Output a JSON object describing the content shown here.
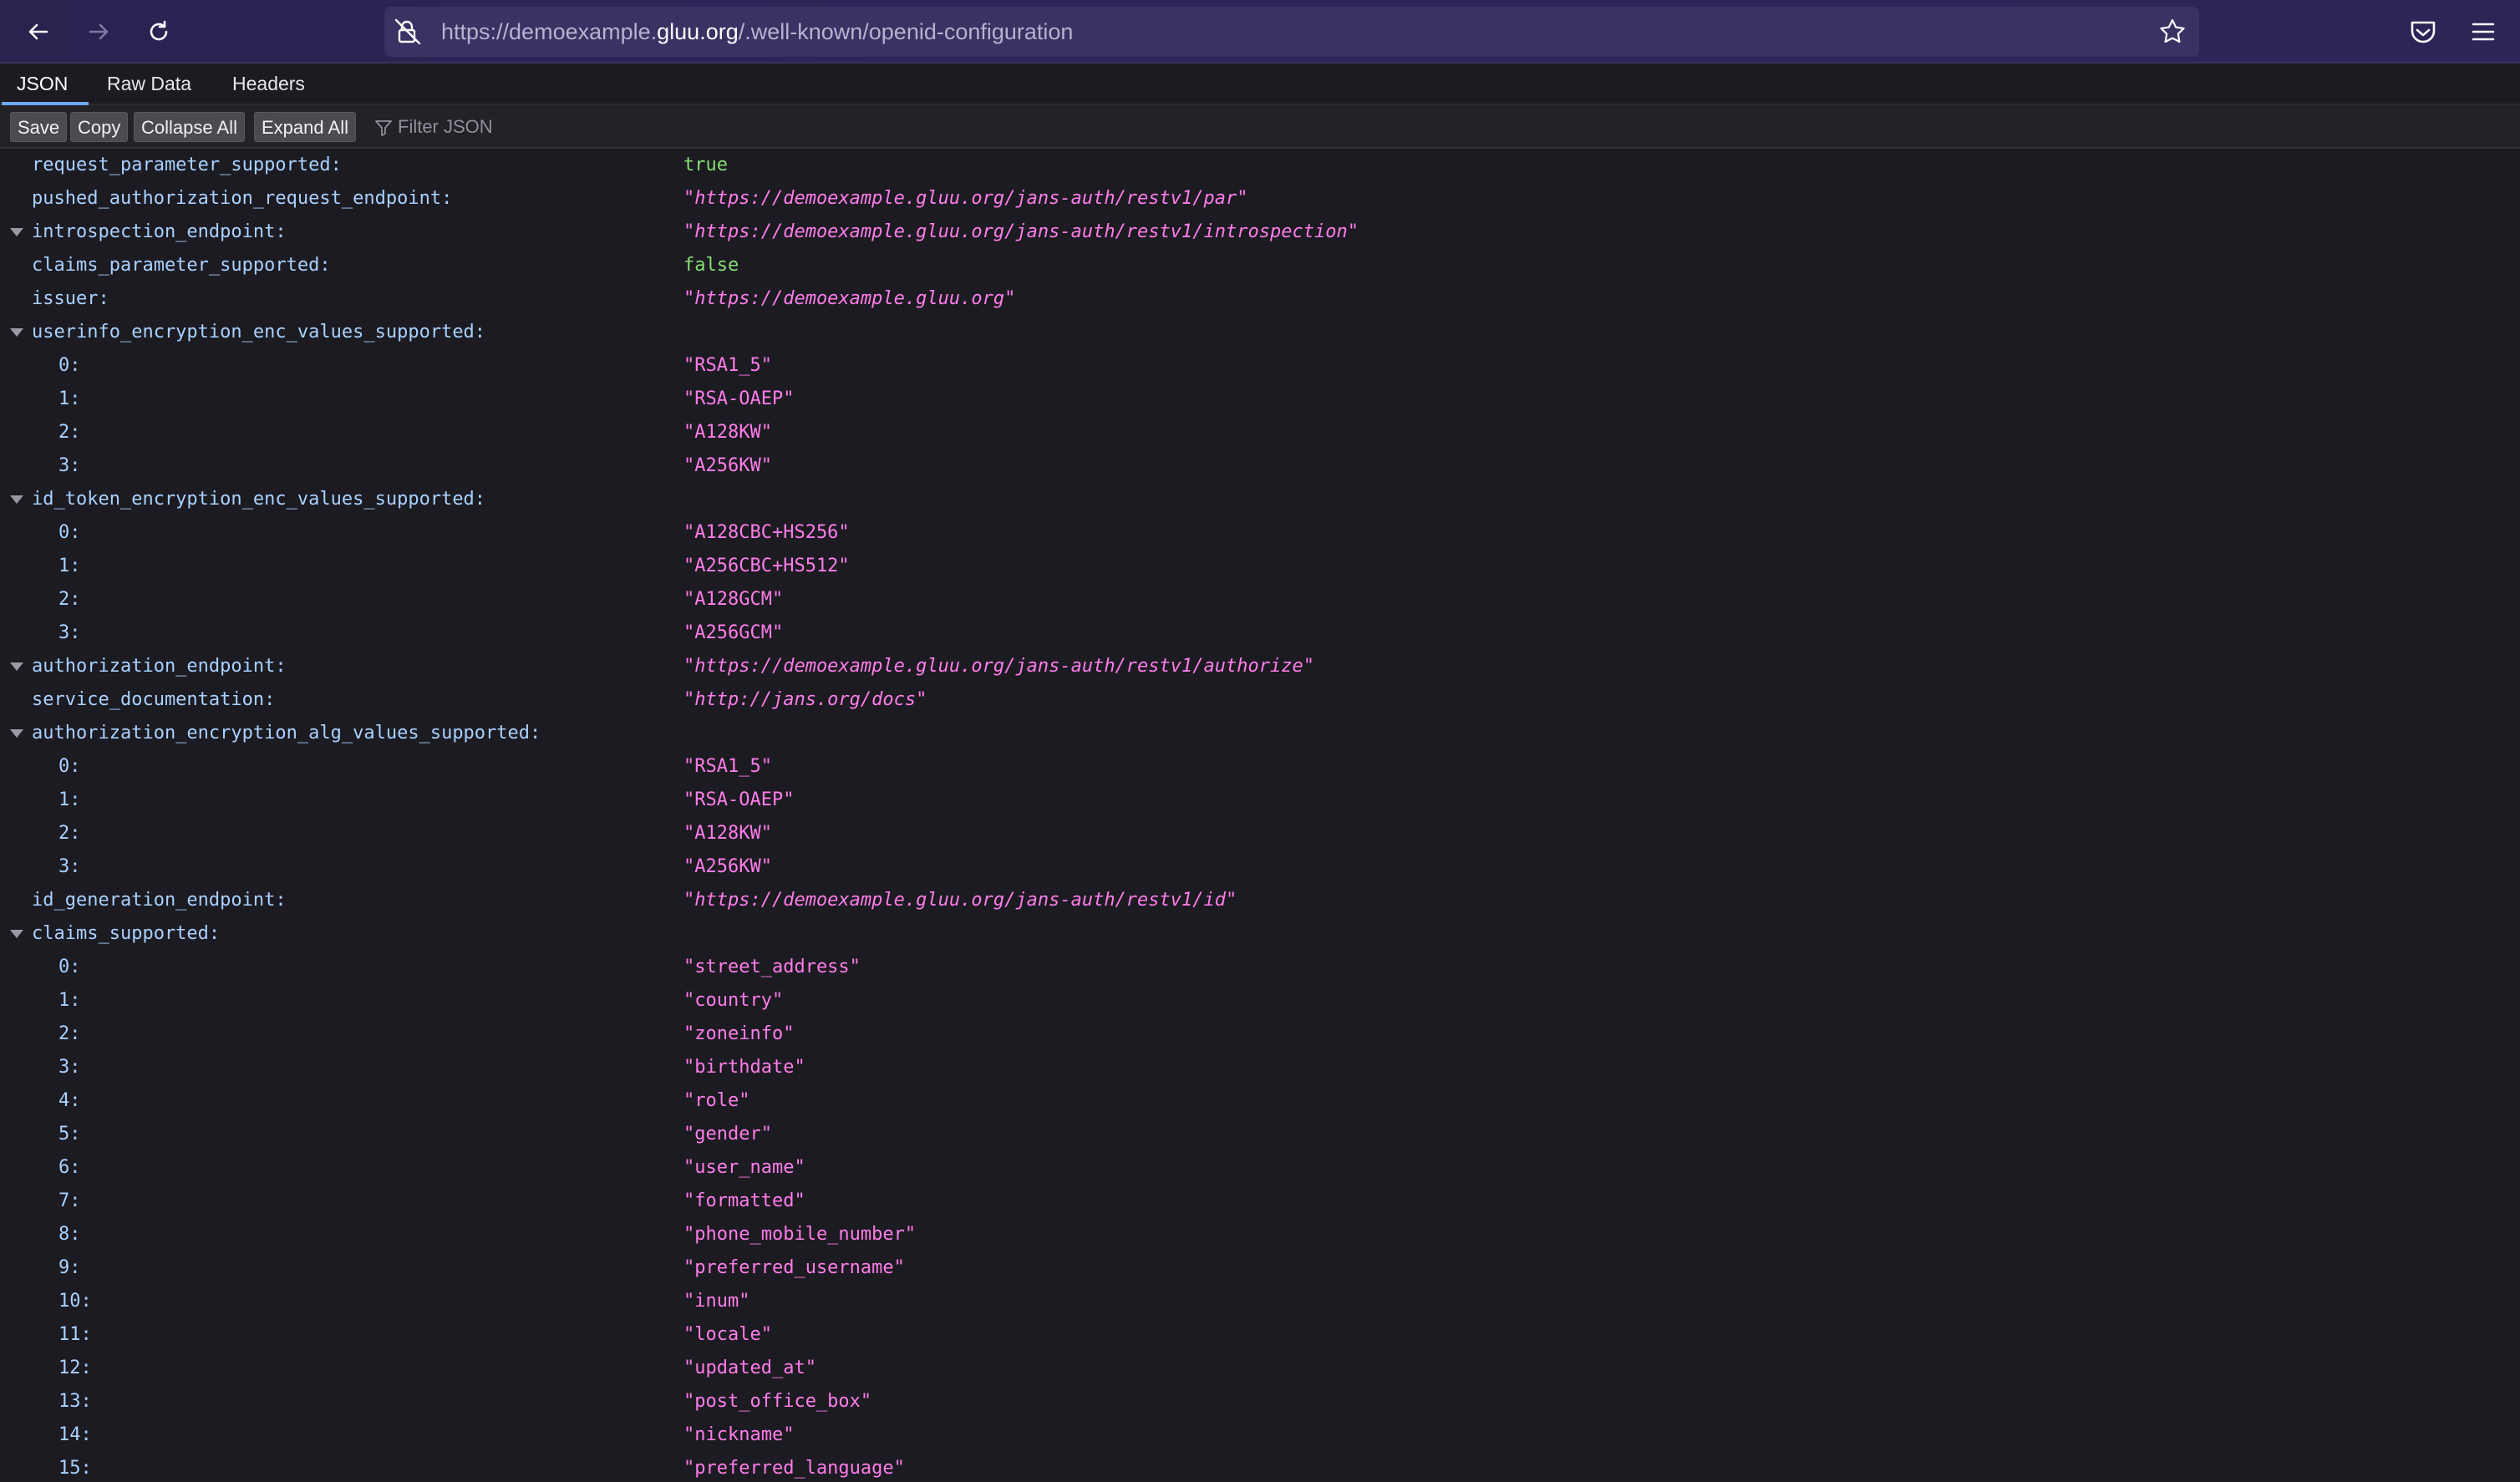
{
  "browser": {
    "url_prefix": "https://demoexample.",
    "url_host": "gluu.org",
    "url_path": "/.well-known/openid-configuration"
  },
  "tabs": [
    {
      "label": "JSON",
      "active": true
    },
    {
      "label": "Raw Data",
      "active": false
    },
    {
      "label": "Headers",
      "active": false
    }
  ],
  "actions": {
    "save": "Save",
    "copy": "Copy",
    "collapse_all": "Collapse All",
    "expand_all": "Expand All",
    "filter_placeholder": "Filter JSON"
  },
  "rows": [
    {
      "key": "request_parameter_supported:",
      "value": "true",
      "type": "bool",
      "level": 0,
      "expandable": false
    },
    {
      "key": "pushed_authorization_request_endpoint:",
      "value": "\"https://demoexample.gluu.org/jans-auth/restv1/par\"",
      "type": "url",
      "level": 0,
      "expandable": false
    },
    {
      "key": "introspection_endpoint:",
      "value": "\"https://demoexample.gluu.org/jans-auth/restv1/introspection\"",
      "type": "url",
      "level": 0,
      "expandable": true
    },
    {
      "key": "claims_parameter_supported:",
      "value": "false",
      "type": "bool",
      "level": 0,
      "expandable": false
    },
    {
      "key": "issuer:",
      "value": "\"https://demoexample.gluu.org\"",
      "type": "url",
      "level": 0,
      "expandable": false
    },
    {
      "key": "userinfo_encryption_enc_values_supported:",
      "value": "",
      "type": "obj",
      "level": 0,
      "expandable": true
    },
    {
      "key": "0:",
      "value": "\"RSA1_5\"",
      "type": "str",
      "level": 1,
      "expandable": false
    },
    {
      "key": "1:",
      "value": "\"RSA-OAEP\"",
      "type": "str",
      "level": 1,
      "expandable": false
    },
    {
      "key": "2:",
      "value": "\"A128KW\"",
      "type": "str",
      "level": 1,
      "expandable": false
    },
    {
      "key": "3:",
      "value": "\"A256KW\"",
      "type": "str",
      "level": 1,
      "expandable": false
    },
    {
      "key": "id_token_encryption_enc_values_supported:",
      "value": "",
      "type": "obj",
      "level": 0,
      "expandable": true
    },
    {
      "key": "0:",
      "value": "\"A128CBC+HS256\"",
      "type": "str",
      "level": 1,
      "expandable": false
    },
    {
      "key": "1:",
      "value": "\"A256CBC+HS512\"",
      "type": "str",
      "level": 1,
      "expandable": false
    },
    {
      "key": "2:",
      "value": "\"A128GCM\"",
      "type": "str",
      "level": 1,
      "expandable": false
    },
    {
      "key": "3:",
      "value": "\"A256GCM\"",
      "type": "str",
      "level": 1,
      "expandable": false
    },
    {
      "key": "authorization_endpoint:",
      "value": "\"https://demoexample.gluu.org/jans-auth/restv1/authorize\"",
      "type": "url",
      "level": 0,
      "expandable": true
    },
    {
      "key": "service_documentation:",
      "value": "\"http://jans.org/docs\"",
      "type": "url",
      "level": 0,
      "expandable": false
    },
    {
      "key": "authorization_encryption_alg_values_supported:",
      "value": "",
      "type": "obj",
      "level": 0,
      "expandable": true
    },
    {
      "key": "0:",
      "value": "\"RSA1_5\"",
      "type": "str",
      "level": 1,
      "expandable": false
    },
    {
      "key": "1:",
      "value": "\"RSA-OAEP\"",
      "type": "str",
      "level": 1,
      "expandable": false
    },
    {
      "key": "2:",
      "value": "\"A128KW\"",
      "type": "str",
      "level": 1,
      "expandable": false
    },
    {
      "key": "3:",
      "value": "\"A256KW\"",
      "type": "str",
      "level": 1,
      "expandable": false
    },
    {
      "key": "id_generation_endpoint:",
      "value": "\"https://demoexample.gluu.org/jans-auth/restv1/id\"",
      "type": "url",
      "level": 0,
      "expandable": false
    },
    {
      "key": "claims_supported:",
      "value": "",
      "type": "obj",
      "level": 0,
      "expandable": true
    },
    {
      "key": "0:",
      "value": "\"street_address\"",
      "type": "str",
      "level": 1,
      "expandable": false
    },
    {
      "key": "1:",
      "value": "\"country\"",
      "type": "str",
      "level": 1,
      "expandable": false
    },
    {
      "key": "2:",
      "value": "\"zoneinfo\"",
      "type": "str",
      "level": 1,
      "expandable": false
    },
    {
      "key": "3:",
      "value": "\"birthdate\"",
      "type": "str",
      "level": 1,
      "expandable": false
    },
    {
      "key": "4:",
      "value": "\"role\"",
      "type": "str",
      "level": 1,
      "expandable": false
    },
    {
      "key": "5:",
      "value": "\"gender\"",
      "type": "str",
      "level": 1,
      "expandable": false
    },
    {
      "key": "6:",
      "value": "\"user_name\"",
      "type": "str",
      "level": 1,
      "expandable": false
    },
    {
      "key": "7:",
      "value": "\"formatted\"",
      "type": "str",
      "level": 1,
      "expandable": false
    },
    {
      "key": "8:",
      "value": "\"phone_mobile_number\"",
      "type": "str",
      "level": 1,
      "expandable": false
    },
    {
      "key": "9:",
      "value": "\"preferred_username\"",
      "type": "str",
      "level": 1,
      "expandable": false
    },
    {
      "key": "10:",
      "value": "\"inum\"",
      "type": "str",
      "level": 1,
      "expandable": false
    },
    {
      "key": "11:",
      "value": "\"locale\"",
      "type": "str",
      "level": 1,
      "expandable": false
    },
    {
      "key": "12:",
      "value": "\"updated_at\"",
      "type": "str",
      "level": 1,
      "expandable": false
    },
    {
      "key": "13:",
      "value": "\"post_office_box\"",
      "type": "str",
      "level": 1,
      "expandable": false
    },
    {
      "key": "14:",
      "value": "\"nickname\"",
      "type": "str",
      "level": 1,
      "expandable": false
    },
    {
      "key": "15:",
      "value": "\"preferred_language\"",
      "type": "str",
      "level": 1,
      "expandable": false
    }
  ]
}
